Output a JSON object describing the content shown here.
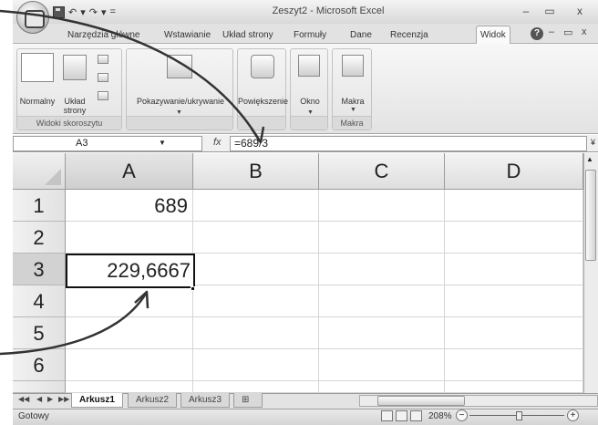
{
  "window": {
    "title": "Zeszyt2 - Microsoft Excel",
    "controls": [
      "–",
      "▭",
      "x"
    ]
  },
  "quick_access": [
    "↶",
    "▾",
    "↷",
    "▾",
    "="
  ],
  "ribbon_tabs": [
    {
      "label": "Narzędzia główne",
      "active": false
    },
    {
      "label": "Wstawianie",
      "active": false
    },
    {
      "label": "Układ strony",
      "active": false
    },
    {
      "label": "Formuły",
      "active": false
    },
    {
      "label": "Dane",
      "active": false
    },
    {
      "label": "Recenzja",
      "active": false
    },
    {
      "label": "Widok",
      "active": true
    }
  ],
  "ribbon_right_controls": [
    "–",
    "▭",
    "x"
  ],
  "ribbon": {
    "group_views": {
      "label": "Widoki skoroszytu",
      "normal": "Normalny",
      "page_layout_1": "Układ",
      "page_layout_2": "strony"
    },
    "show_hide": "Pokazywanie/ukrywanie",
    "zoom": "Powiększenie",
    "window": "Okno",
    "macros_btn": "Makra",
    "macros_group": "Makra"
  },
  "formula_bar": {
    "name_box": "A3",
    "fx": "fx",
    "formula": "=689/3"
  },
  "grid": {
    "columns": [
      "A",
      "B",
      "C",
      "D"
    ],
    "rows": [
      "1",
      "2",
      "3",
      "4",
      "5",
      "6"
    ],
    "cells": {
      "A1": "689",
      "A3": "229,6667"
    },
    "active_cell": "A3"
  },
  "sheet_tabs": [
    {
      "label": "Arkusz1",
      "active": true
    },
    {
      "label": "Arkusz2",
      "active": false
    },
    {
      "label": "Arkusz3",
      "active": false
    }
  ],
  "status": {
    "ready": "Gotowy",
    "zoom": "208%",
    "zoom_level": 0.5
  }
}
